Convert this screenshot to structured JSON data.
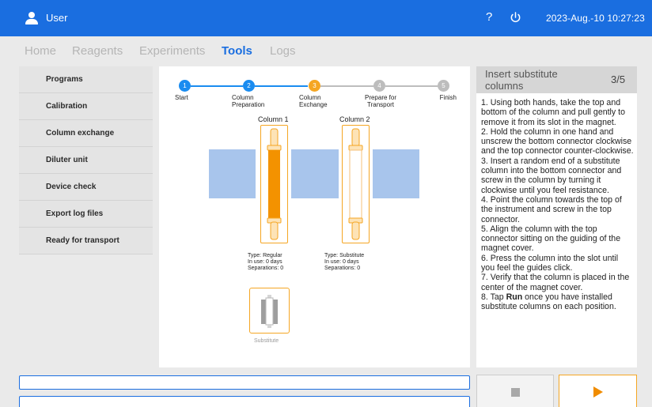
{
  "header": {
    "user_label": "User",
    "help_icon": "?",
    "datetime": "2023-Aug.-10  10:27:23",
    "colors": {
      "bar": "#1a6ee0"
    }
  },
  "nav": {
    "tabs": [
      {
        "label": "Home",
        "active": false
      },
      {
        "label": "Reagents",
        "active": false
      },
      {
        "label": "Experiments",
        "active": false
      },
      {
        "label": "Tools",
        "active": true
      },
      {
        "label": "Logs",
        "active": false
      }
    ]
  },
  "sidebar": {
    "items": [
      {
        "label": "Programs"
      },
      {
        "label": "Calibration"
      },
      {
        "label": "Column exchange"
      },
      {
        "label": "Diluter unit"
      },
      {
        "label": "Device check"
      },
      {
        "label": "Export log files"
      },
      {
        "label": "Ready for transport"
      }
    ]
  },
  "stepper": {
    "steps": [
      {
        "num": "1",
        "label": "Start",
        "state": "done"
      },
      {
        "num": "2",
        "label": "Column\nPreparation",
        "state": "done"
      },
      {
        "num": "3",
        "label": "Column\nExchange",
        "state": "current"
      },
      {
        "num": "4",
        "label": "Prepare for\nTransport",
        "state": "pending"
      },
      {
        "num": "5",
        "label": "Finish",
        "state": "pending"
      }
    ],
    "colors": {
      "done": "#1a8cf0",
      "current": "#f5a623",
      "pending": "#bdbdbd"
    }
  },
  "columns": [
    {
      "title": "Column 1",
      "type": "Type: Regular",
      "in_use": "In use: 0 days",
      "separations": "Separations: 0"
    },
    {
      "title": "Column 2",
      "type": "Type: Substitute",
      "in_use": "In use: 0 days",
      "separations": "Separations: 0"
    }
  ],
  "substitute": {
    "label": "Substitute"
  },
  "instructions": {
    "title": "Insert substitute columns",
    "counter": "3/5",
    "steps": [
      "1. Using both hands, take the top and bottom of the column and pull gently to remove it from its slot in the magnet.",
      "2. Hold the column in one hand and unscrew the bottom connector clockwise and the top connector counter-clockwise.",
      "3. Insert a random end of a substitute column into the bottom connector and screw in the column by turning it clockwise until you feel resistance.",
      "4. Point the column towards the top of the instrument and screw in the top connector.",
      "5. Align the column with the top connector sitting on the guiding of the magnet cover.",
      "6. Press the column into the slot until you feel the guides click.",
      "7. Verify that the column is placed in the center of the magnet cover."
    ],
    "last_step": {
      "prefix": "8. Tap ",
      "bold": "Run",
      "suffix": " once you have installed substitute columns on each position."
    }
  },
  "icons": {
    "user": "user-icon",
    "help": "help-icon",
    "power": "power-icon",
    "stop": "stop-icon",
    "run": "play-icon"
  }
}
